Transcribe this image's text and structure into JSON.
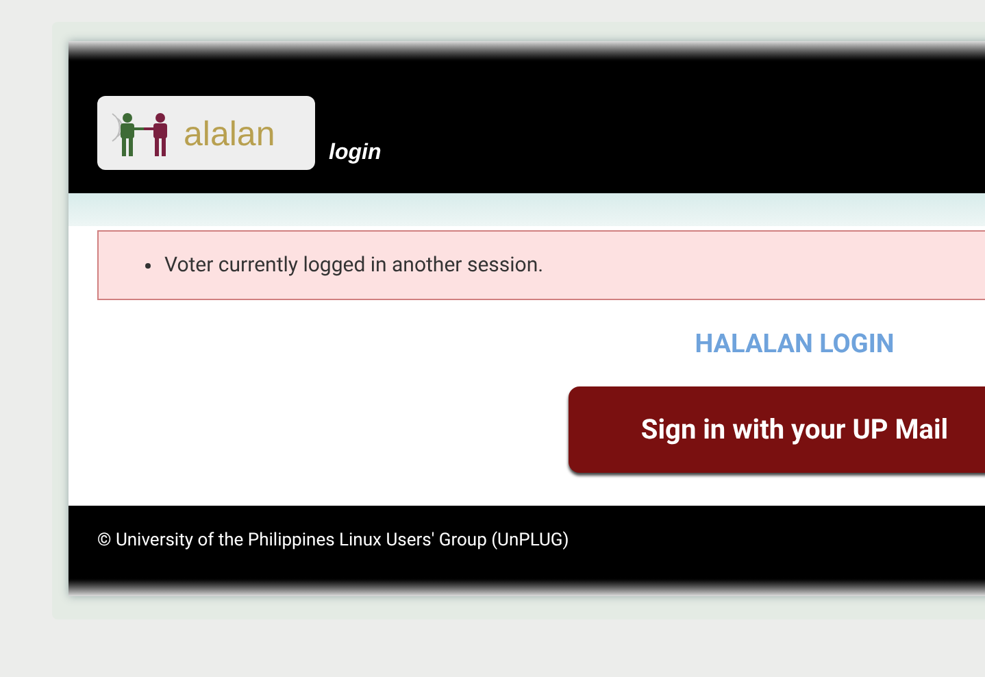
{
  "header": {
    "logo_text": "alalan",
    "subtitle": "login"
  },
  "alerts": [
    "Voter currently logged in another session."
  ],
  "heading": "HALALAN LOGIN",
  "signin_button": "Sign in with your UP Mail",
  "footer": "© University of the Philippines Linux Users' Group (UnPLUG)"
}
